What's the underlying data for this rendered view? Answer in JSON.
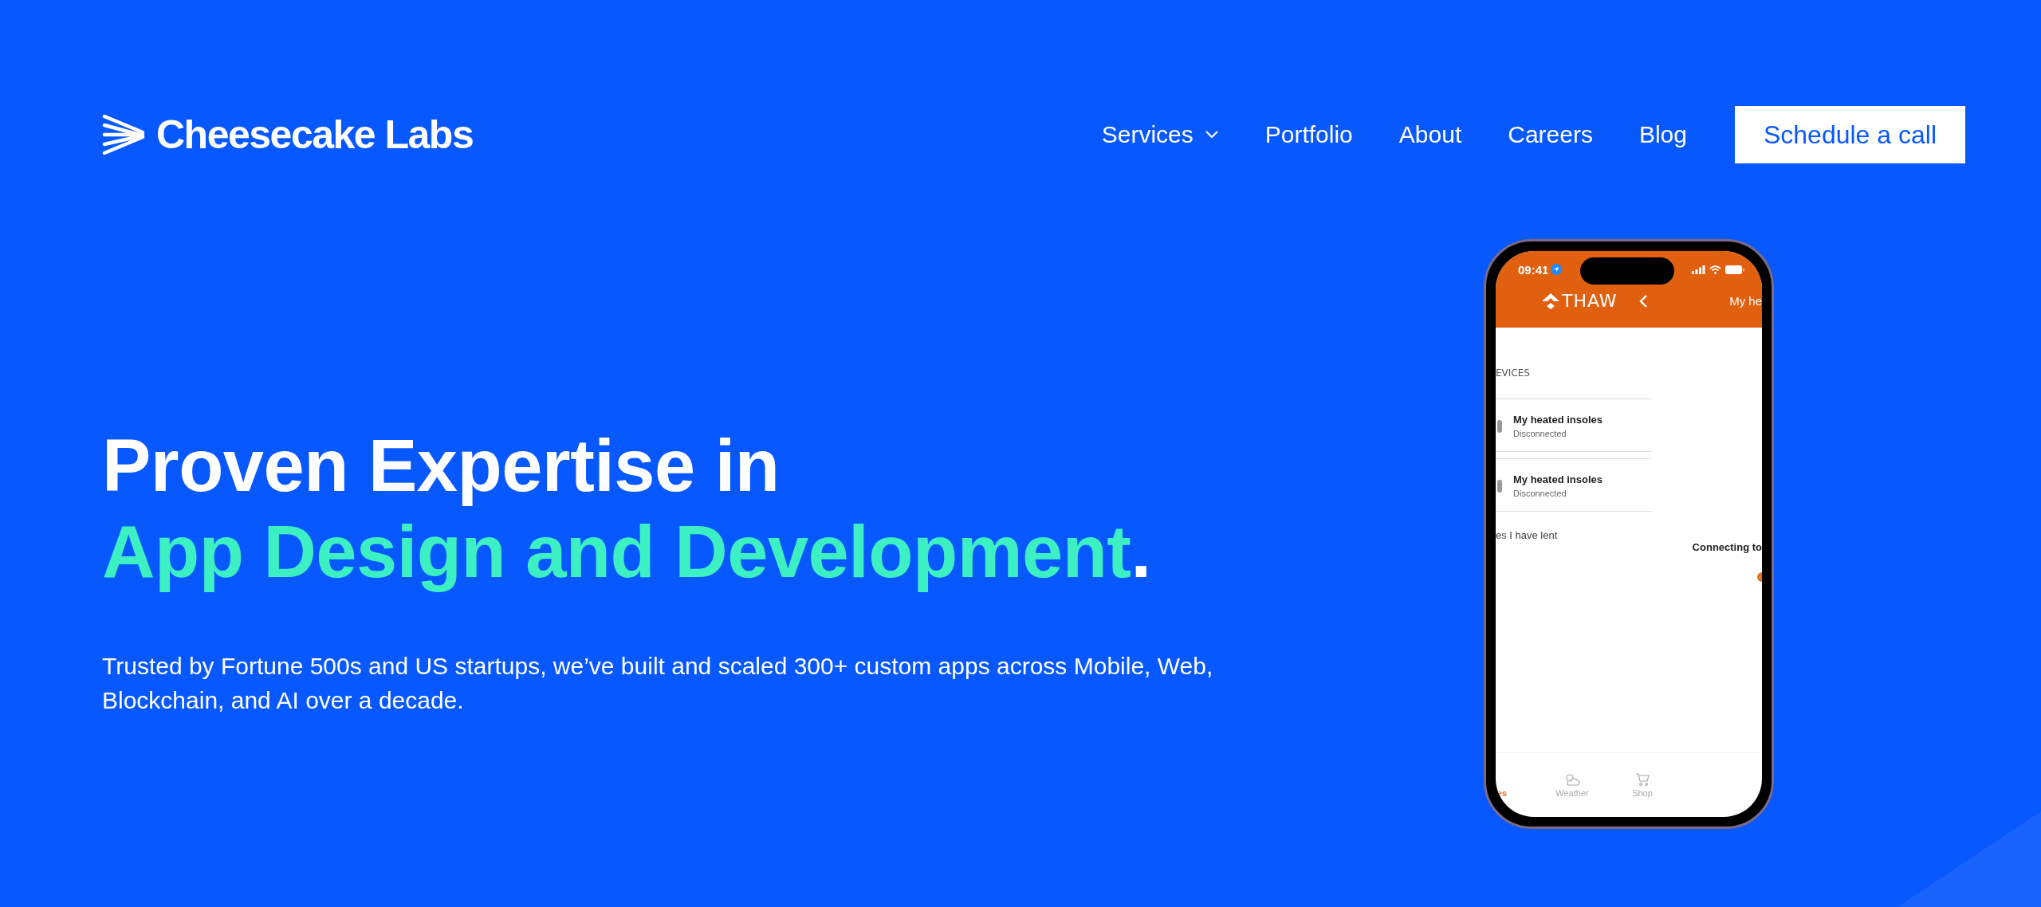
{
  "header": {
    "logo": "Cheesecake Labs",
    "nav": [
      {
        "label": "Services",
        "dropdown": true
      },
      {
        "label": "Portfolio",
        "dropdown": false
      },
      {
        "label": "About",
        "dropdown": false
      },
      {
        "label": "Careers",
        "dropdown": false
      },
      {
        "label": "Blog",
        "dropdown": false
      }
    ],
    "cta": "Schedule a call"
  },
  "hero": {
    "headline_line1": "Proven Expertise in",
    "headline_line2": "App Design and Development",
    "headline_period": ".",
    "description": "Trusted by Fortune 500s and US startups, we’ve built and scaled 300+ custom apps across Mobile, Web, Blockchain, and AI over a decade."
  },
  "phone": {
    "time": "09:41",
    "brand": "THAW",
    "header_title": "My he",
    "section_label": "EVICES",
    "devices": [
      {
        "name": "My heated insoles",
        "status": "Disconnected"
      },
      {
        "name": "My heated insoles",
        "status": "Disconnected"
      }
    ],
    "lent_label": "es I have lent",
    "connecting": "Connecting to",
    "tabs": [
      {
        "label": "es",
        "selected": true
      },
      {
        "label": "Weather",
        "selected": false
      },
      {
        "label": "Shop",
        "selected": false
      }
    ]
  }
}
